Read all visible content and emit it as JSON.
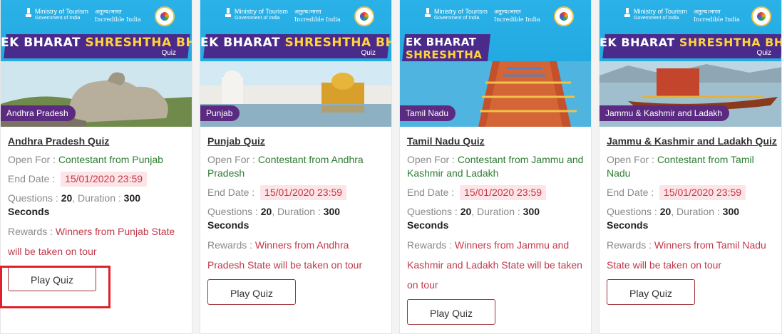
{
  "banner": {
    "ministry_line1": "Ministry of Tourism",
    "ministry_line2": "Government of India",
    "incredible_line1": "अतुल्य।भारत",
    "incredible_line2": "Incredible India",
    "title_part1": "EK BHARAT",
    "title_part2": "SHRESHTHA BHARAT",
    "quiz_word": "Quiz"
  },
  "cards": [
    {
      "region": "Andhra Pradesh",
      "title": "Andhra Pradesh Quiz",
      "open_for_label": "Open For : ",
      "open_for": "Contestant from Punjab",
      "end_date_label": "End Date : ",
      "end_date": "15/01/2020 23:59",
      "questions_label": "Questions : ",
      "questions": "20",
      "duration_label": ", Duration : ",
      "duration": "300",
      "seconds": "Seconds",
      "rewards_label": "Rewards : ",
      "rewards": "Winners from Punjab State will be taken on tour",
      "button": "Play Quiz"
    },
    {
      "region": "Punjab",
      "title": "Punjab Quiz",
      "open_for_label": "Open For : ",
      "open_for": "Contestant from Andhra Pradesh",
      "end_date_label": "End Date : ",
      "end_date": "15/01/2020 23:59",
      "questions_label": "Questions : ",
      "questions": "20",
      "duration_label": ", Duration : ",
      "duration": "300",
      "seconds": "Seconds",
      "rewards_label": "Rewards : ",
      "rewards": "Winners from Andhra Pradesh State will be taken on tour",
      "button": "Play Quiz"
    },
    {
      "region": "Tamil Nadu",
      "title": "Tamil Nadu Quiz",
      "open_for_label": "Open For : ",
      "open_for": "Contestant from Jammu and Kashmir and Ladakh",
      "end_date_label": "End Date : ",
      "end_date": "15/01/2020 23:59",
      "questions_label": "Questions : ",
      "questions": "20",
      "duration_label": ", Duration : ",
      "duration": "300",
      "seconds": "Seconds",
      "rewards_label": "Rewards : ",
      "rewards": "Winners from Jammu and Kashmir and Ladakh State will be taken on tour",
      "button": "Play Quiz"
    },
    {
      "region": "Jammu & Kashmir and Ladakh",
      "title": "Jammu & Kashmir and Ladakh Quiz",
      "open_for_label": "Open For : ",
      "open_for": "Contestant from Tamil Nadu",
      "end_date_label": "End Date : ",
      "end_date": "15/01/2020 23:59",
      "questions_label": "Questions : ",
      "questions": "20",
      "duration_label": ", Duration : ",
      "duration": "300",
      "seconds": "Seconds",
      "rewards_label": "Rewards : ",
      "rewards": "Winners from Tamil Nadu State will be taken on tour",
      "button": "Play Quiz"
    }
  ],
  "colors": {
    "banner_blue": "#22a8e0",
    "purple": "#4a2a8a",
    "region_label": "#5b2b82",
    "open_for_green": "#2e7d32",
    "reward_red": "#c0394b",
    "highlight_red": "#e0202a"
  }
}
